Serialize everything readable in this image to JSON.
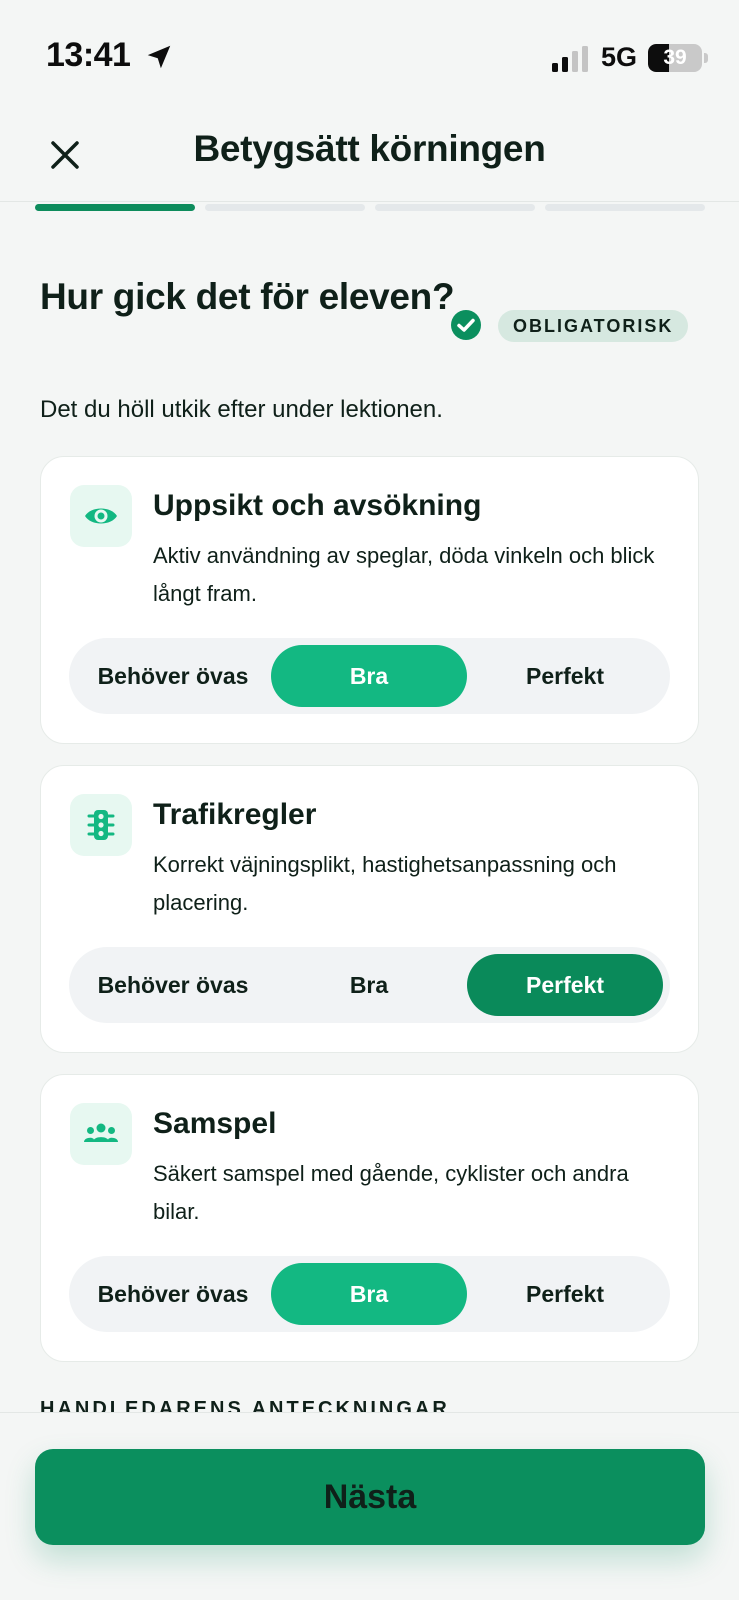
{
  "status_bar": {
    "time": "13:41",
    "network": "5G",
    "battery": "39",
    "battery_level_percent": 39
  },
  "header": {
    "title": "Betygsätt körningen",
    "close_icon": "close-icon"
  },
  "progress": {
    "steps_total": 4,
    "current_step": 1,
    "active_color": "#0d8c5c"
  },
  "question": {
    "title": "Hur gick det för eleven?",
    "required_label": "OBLIGATORISK",
    "subtitle": "Det du höll utkik efter under lektionen."
  },
  "criteria": [
    {
      "icon": "eye-icon",
      "title": "Uppsikt och avsökning",
      "description": "Aktiv användning av speglar, döda vinkeln och blick långt fram.",
      "options": [
        "Behöver övas",
        "Bra",
        "Perfekt"
      ],
      "selected": "Bra"
    },
    {
      "icon": "traffic-light-icon",
      "title": "Trafikregler",
      "description": "Korrekt väjningsplikt, hastighetsanpassning och placering.",
      "options": [
        "Behöver övas",
        "Bra",
        "Perfekt"
      ],
      "selected": "Perfekt"
    },
    {
      "icon": "group-icon",
      "title": "Samspel",
      "description": "Säkert samspel med gående, cyklister och andra bilar.",
      "options": [
        "Behöver övas",
        "Bra",
        "Perfekt"
      ],
      "selected": "Bra"
    }
  ],
  "notes_section": {
    "label": "HANDLEDARENS ANTECKNINGAR"
  },
  "footer": {
    "next_label": "Nästa"
  },
  "colors": {
    "accent": "#0b8f5e",
    "selected_good": "#13b882",
    "selected_perfect": "#0a8a5a",
    "icon_tint": "#13b882"
  }
}
